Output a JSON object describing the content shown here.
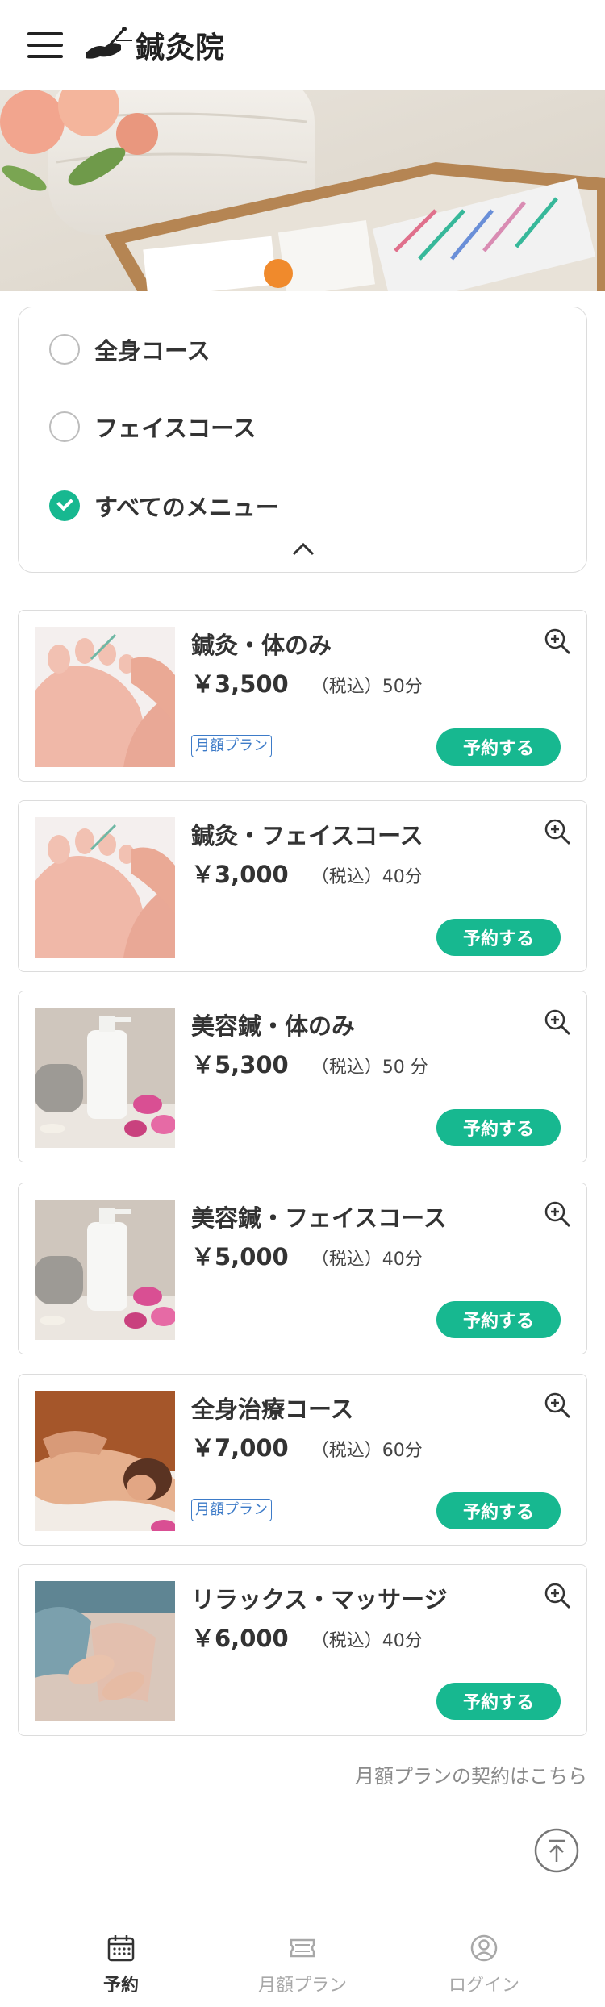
{
  "header": {
    "logo_text": "鍼灸院"
  },
  "filter": {
    "options": [
      {
        "label": "全身コース",
        "checked": false
      },
      {
        "label": "フェイスコース",
        "checked": false
      },
      {
        "label": "すべてのメニュー",
        "checked": true
      }
    ]
  },
  "menus": [
    {
      "title": "鍼灸・体のみ",
      "price": "￥3,500",
      "note": "（税込）50分",
      "badge": "月額プラン",
      "button": "予約する"
    },
    {
      "title": "鍼灸・フェイスコース",
      "price": "￥3,000",
      "note": "（税込）40分",
      "badge": "",
      "button": "予約する"
    },
    {
      "title": "美容鍼・体のみ",
      "price": "￥5,300",
      "note": "（税込）50 分",
      "badge": "",
      "button": "予約する"
    },
    {
      "title": "美容鍼・フェイスコース",
      "price": "￥5,000",
      "note": "（税込）40分",
      "badge": "",
      "button": "予約する"
    },
    {
      "title": "全身治療コース",
      "price": "￥7,000",
      "note": "（税込）60分",
      "badge": "月額プラン",
      "button": "予約する"
    },
    {
      "title": "リラックス・マッサージ",
      "price": "￥6,000",
      "note": "（税込）40分",
      "badge": "",
      "button": "予約する"
    }
  ],
  "monthly_link": "月額プランの契約はこちら",
  "tabs": [
    {
      "label": "予約",
      "icon": "calendar-icon",
      "active": true
    },
    {
      "label": "月額プラン",
      "icon": "ticket-icon",
      "active": false
    },
    {
      "label": "ログイン",
      "icon": "user-icon",
      "active": false
    }
  ],
  "colors": {
    "accent": "#17b890",
    "badge": "#3d7bc8",
    "muted": "#8a8a8a"
  }
}
